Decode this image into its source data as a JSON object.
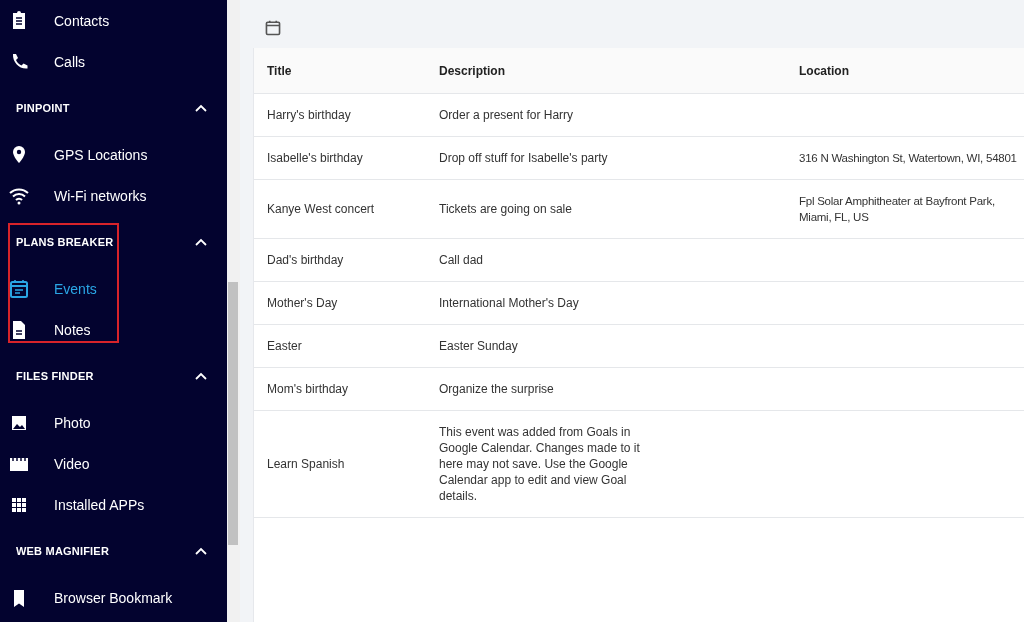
{
  "sidebar": {
    "sections": [
      {
        "highlighted": false,
        "items": [
          {
            "label": "Contacts",
            "selected": false
          },
          {
            "label": "Calls",
            "selected": false
          }
        ]
      },
      {
        "title": "PINPOINT",
        "expanded": true,
        "highlighted": false,
        "items": [
          {
            "label": "GPS Locations",
            "selected": false
          },
          {
            "label": "Wi-Fi networks",
            "selected": false
          }
        ]
      },
      {
        "title": "PLANS BREAKER",
        "expanded": true,
        "highlighted": true,
        "items": [
          {
            "label": "Events",
            "selected": true
          },
          {
            "label": "Notes",
            "selected": false
          }
        ]
      },
      {
        "title": "FILES FINDER",
        "expanded": true,
        "highlighted": false,
        "items": [
          {
            "label": "Photo",
            "selected": false
          },
          {
            "label": "Video",
            "selected": false
          },
          {
            "label": "Installed APPs",
            "selected": false
          }
        ]
      },
      {
        "title": "WEB MAGNIFIER",
        "expanded": true,
        "highlighted": false,
        "items": [
          {
            "label": "Browser Bookmark",
            "selected": false
          }
        ]
      }
    ]
  },
  "table": {
    "columns": [
      "Title",
      "Description",
      "Location"
    ],
    "rows": [
      [
        "Harry's birthday",
        "Order a present for Harry",
        ""
      ],
      [
        "Isabelle's birthday",
        "Drop off stuff for Isabelle's party",
        "316 N Washington St, Watertown, WI, 54801"
      ],
      [
        "Kanye West concert",
        "Tickets are going on sale",
        "Fpl Solar Amphitheater at Bayfront Park, Miami, FL, US"
      ],
      [
        "Dad's birthday",
        "Call dad",
        ""
      ],
      [
        "Mother's Day",
        "International Mother's Day",
        ""
      ],
      [
        "Easter",
        "Easter Sunday",
        ""
      ],
      [
        "Mom's birthday",
        "Organize the surprise",
        ""
      ],
      [
        "Learn Spanish",
        "This event was added from Goals in Google Calendar. Changes made to it here may not save. Use the Google Calendar app to edit and view Goal details.",
        ""
      ]
    ]
  }
}
